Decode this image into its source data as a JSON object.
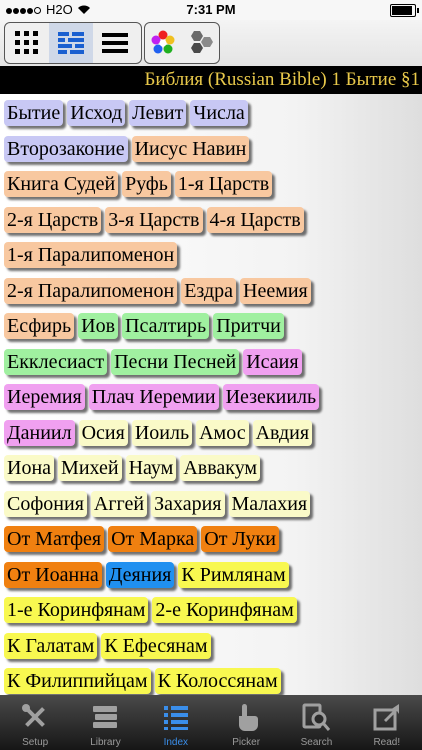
{
  "status_bar": {
    "carrier": "H2O",
    "time": "7:31 PM"
  },
  "toolbar": {
    "view_buttons": [
      "grid-view-icon",
      "list-view-icon",
      "lines-view-icon"
    ],
    "option_buttons": [
      "color-wheel-icon",
      "hexagon-icon"
    ]
  },
  "title": "Библия (Russian Bible) 1 Бытие §1",
  "colors": {
    "lavender": "#c8c8f4",
    "peach": "#f8c8a0",
    "green": "#a0f0a0",
    "pink": "#f0a0f0",
    "cream": "#fafac8",
    "orange": "#f08010",
    "blue": "#2090f0",
    "yellow": "#f8f850"
  },
  "books": [
    [
      {
        "name": "Бытие",
        "color": "lavender"
      },
      {
        "name": "Исход",
        "color": "lavender"
      },
      {
        "name": "Левит",
        "color": "lavender"
      },
      {
        "name": "Числа",
        "color": "lavender"
      }
    ],
    [
      {
        "name": "Второзаконие",
        "color": "lavender"
      },
      {
        "name": "Иисус Навин",
        "color": "peach"
      }
    ],
    [
      {
        "name": "Книга Судей",
        "color": "peach"
      },
      {
        "name": "Руфь",
        "color": "peach"
      },
      {
        "name": "1-я Царств",
        "color": "peach"
      }
    ],
    [
      {
        "name": "2-я Царств",
        "color": "peach"
      },
      {
        "name": "3-я Царств",
        "color": "peach"
      },
      {
        "name": "4-я Царств",
        "color": "peach"
      }
    ],
    [
      {
        "name": "1-я Паралипоменон",
        "color": "peach"
      }
    ],
    [
      {
        "name": "2-я Паралипоменон",
        "color": "peach"
      },
      {
        "name": "Ездра",
        "color": "peach"
      },
      {
        "name": "Неемия",
        "color": "peach"
      }
    ],
    [
      {
        "name": "Есфирь",
        "color": "peach"
      },
      {
        "name": "Иов",
        "color": "green"
      },
      {
        "name": "Псалтирь",
        "color": "green"
      },
      {
        "name": "Притчи",
        "color": "green"
      }
    ],
    [
      {
        "name": "Екклесиаст",
        "color": "green"
      },
      {
        "name": "Песни Песней",
        "color": "green"
      },
      {
        "name": "Исаия",
        "color": "pink"
      }
    ],
    [
      {
        "name": "Иеремия",
        "color": "pink"
      },
      {
        "name": "Плач Иеремии",
        "color": "pink"
      },
      {
        "name": "Иезекииль",
        "color": "pink"
      }
    ],
    [
      {
        "name": "Даниил",
        "color": "pink"
      },
      {
        "name": "Осия",
        "color": "cream"
      },
      {
        "name": "Иоиль",
        "color": "cream"
      },
      {
        "name": "Амос",
        "color": "cream"
      },
      {
        "name": "Авдия",
        "color": "cream"
      }
    ],
    [
      {
        "name": "Иона",
        "color": "cream"
      },
      {
        "name": "Михей",
        "color": "cream"
      },
      {
        "name": "Наум",
        "color": "cream"
      },
      {
        "name": "Аввакум",
        "color": "cream"
      }
    ],
    [
      {
        "name": "Софония",
        "color": "cream"
      },
      {
        "name": "Аггей",
        "color": "cream"
      },
      {
        "name": "Захария",
        "color": "cream"
      },
      {
        "name": "Малахия",
        "color": "cream"
      }
    ],
    [
      {
        "name": "От Матфея",
        "color": "orange"
      },
      {
        "name": "От Марка",
        "color": "orange"
      },
      {
        "name": "От Луки",
        "color": "orange"
      }
    ],
    [
      {
        "name": "От Иоанна",
        "color": "orange"
      },
      {
        "name": "Деяния",
        "color": "blue"
      },
      {
        "name": "К Римлянам",
        "color": "yellow"
      }
    ],
    [
      {
        "name": "1-е Коринфянам",
        "color": "yellow"
      },
      {
        "name": "2-е Коринфянам",
        "color": "yellow"
      }
    ],
    [
      {
        "name": "К Галатам",
        "color": "yellow"
      },
      {
        "name": "К Ефесянам",
        "color": "yellow"
      }
    ],
    [
      {
        "name": "К Филиппийцам",
        "color": "yellow"
      },
      {
        "name": "К Колоссянам",
        "color": "yellow"
      }
    ]
  ],
  "tabs": [
    {
      "label": "Setup",
      "icon": "tools-icon",
      "active": false
    },
    {
      "label": "Library",
      "icon": "books-icon",
      "active": false
    },
    {
      "label": "Index",
      "icon": "index-list-icon",
      "active": true
    },
    {
      "label": "Picker",
      "icon": "hand-pointer-icon",
      "active": false
    },
    {
      "label": "Search",
      "icon": "search-icon",
      "active": false
    },
    {
      "label": "Read!",
      "icon": "share-arrow-icon",
      "active": false
    }
  ]
}
